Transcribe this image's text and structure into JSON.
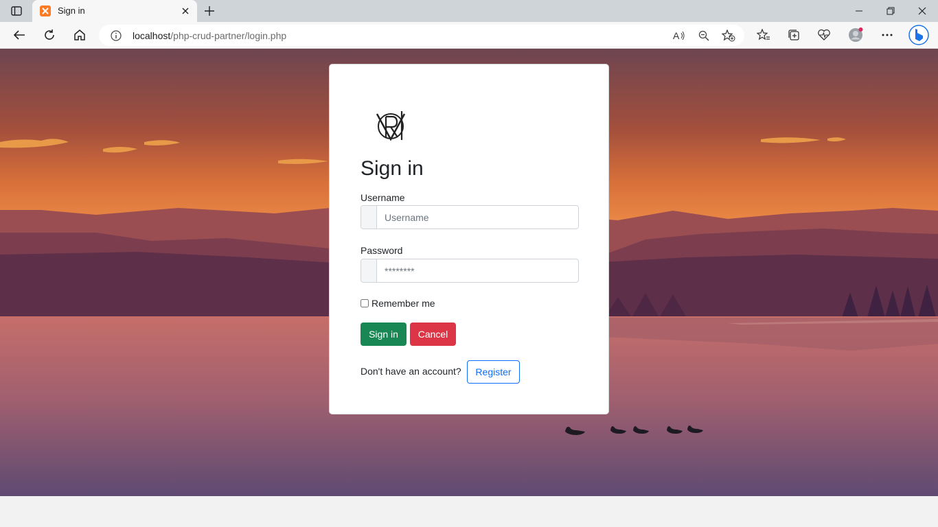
{
  "browser": {
    "tab": {
      "title": "Sign in",
      "favicon": "xampp-icon"
    },
    "address": {
      "host": "localhost",
      "path": "/php-crud-partner/login.php"
    },
    "icons": [
      "tab-actions-icon",
      "close-icon",
      "plus-icon",
      "minimize-icon",
      "restore-icon",
      "window-close-icon",
      "back-arrow-icon",
      "refresh-icon",
      "home-icon",
      "info-icon",
      "read-aloud-icon",
      "zoom-out-icon",
      "add-favorite-icon",
      "favorites-icon",
      "collections-icon",
      "browser-essentials-icon",
      "profile-icon",
      "more-icon",
      "bing-chat-icon"
    ]
  },
  "login": {
    "title": "Sign in",
    "username": {
      "label": "Username",
      "placeholder": "Username"
    },
    "password": {
      "label": "Password",
      "placeholder": "********"
    },
    "remember_label": "Remember me",
    "remember_checked": false,
    "signin_label": "Sign in",
    "cancel_label": "Cancel",
    "no_account_text": "Don't have an account?",
    "register_label": "Register"
  },
  "colors": {
    "signin": "#198754",
    "cancel": "#dc3545",
    "register": "#0d6efd"
  }
}
